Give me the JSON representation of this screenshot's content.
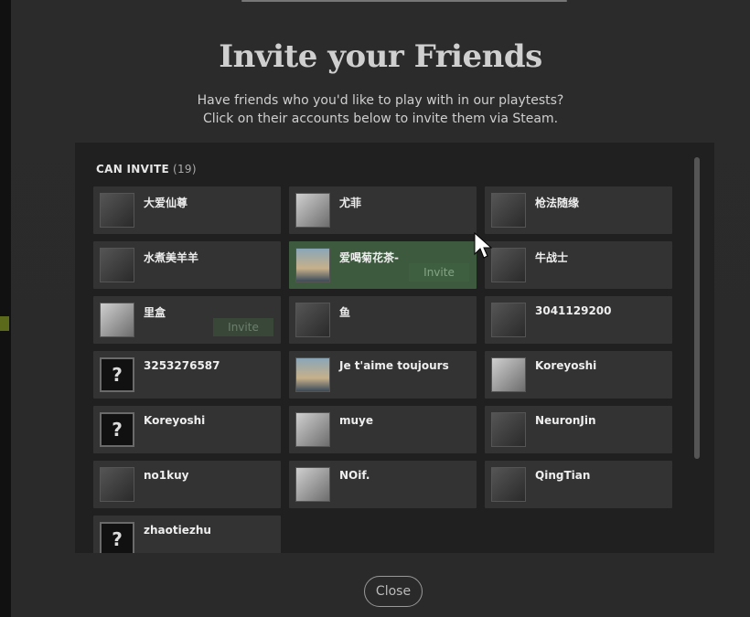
{
  "header": {
    "title": "Invite your Friends",
    "subtitle_line1": "Have friends who you'd like to play with in our playtests?",
    "subtitle_line2": "Click on their accounts below to invite them via Steam."
  },
  "section": {
    "label": "CAN INVITE",
    "count": "(19)"
  },
  "invite_label": "Invite",
  "friends": [
    {
      "name": "大爱仙尊",
      "avatar": "photo-avatar"
    },
    {
      "name": "尤菲",
      "avatar": "anime-avatar"
    },
    {
      "name": "枪法随缘",
      "avatar": "photo-avatar"
    },
    {
      "name": "水煮美羊羊",
      "avatar": "photo-avatar"
    },
    {
      "name": "爱喝菊花茶-",
      "avatar": "landscape-avatar"
    },
    {
      "name": "牛战士",
      "avatar": "photo-avatar"
    },
    {
      "name": "里盒",
      "avatar": "anime-avatar"
    },
    {
      "name": "鱼",
      "avatar": "photo-avatar"
    },
    {
      "name": "3041129200",
      "avatar": "photo-avatar"
    },
    {
      "name": "3253276587",
      "avatar": "unknown-avatar"
    },
    {
      "name": "Je t'aime toujours",
      "avatar": "landscape-avatar"
    },
    {
      "name": "Koreyoshi",
      "avatar": "anime-avatar"
    },
    {
      "name": "Koreyoshi",
      "avatar": "unknown-avatar"
    },
    {
      "name": "muye",
      "avatar": "anime-avatar"
    },
    {
      "name": "NeuronJin",
      "avatar": "photo-avatar"
    },
    {
      "name": "no1kuy",
      "avatar": "photo-avatar"
    },
    {
      "name": "NOif.",
      "avatar": "anime-avatar"
    },
    {
      "name": "QingTian",
      "avatar": "photo-avatar"
    },
    {
      "name": "zhaotiezhu",
      "avatar": "unknown-avatar"
    }
  ],
  "unknown_glyph": "?",
  "close_label": "Close"
}
